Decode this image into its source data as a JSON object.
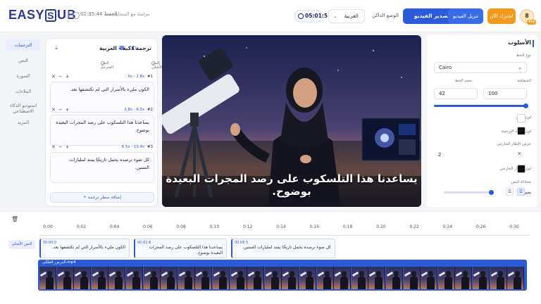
{
  "header": {
    "logo": "EASYSUB",
    "autosave_time": "02:35:44 الحفظ",
    "autosave_text": "مزامنة مع السحابة بعد",
    "duration": "05:01:51",
    "language": "العربية",
    "dark_mode": "الوضع الداكن",
    "export_label": "تصدير الفيديو",
    "download_label": "تنزيل الفيديو",
    "subscribe_label": "اشترك الآن",
    "avatar_initial": "8",
    "pro_badge": "Pro"
  },
  "nav": {
    "items": [
      "الترجمات",
      "النص",
      "الصورة",
      "الملاءات",
      "استوديو الذكاء الاصطناعي",
      "المزيد"
    ]
  },
  "subtitles": {
    "title": "ترجمة ذكية - العربية",
    "original_text_label": "النص الأصلي",
    "translated_text_label": "النص المترجم",
    "cues": [
      {
        "index": "#1",
        "time": "0s - 2.8s",
        "text": "الكون مليء بالأسرار التي لم نكتشفها بعد."
      },
      {
        "index": "#2",
        "time": "2.8s - 6.5s",
        "text": "يساعدنا هذا التلسكوب على رصد المجرات البعيدة بوضوح."
      },
      {
        "index": "#3",
        "time": "6.5s - 10.4s",
        "text": "كل ضوء نرصده يحمل تاريخًا يمتد لمليارات السنين."
      }
    ],
    "add_line_label": "+ إضافة سطر ترجمة"
  },
  "video": {
    "caption": "يساعدنا هذا التلسكوب على رصد المجرات البعيدة بوضوح."
  },
  "style": {
    "title": "الأسلوب",
    "font_type_label": "نوع الخط",
    "font_value": "Cairo",
    "font_size_label": "حجم الخط",
    "font_size_value": "42",
    "opacity_label": "الشفافية",
    "opacity_value": "100",
    "text_color_label": "لون النص",
    "text_color": "#ffffff",
    "bg_color_label": "لون خلفية الترجمة",
    "bg_color": "#111111",
    "outline_width_label": "عرض الإطار الخارجي",
    "outline_width_value": "2",
    "outline_color_label": "لون الإطار الخارجي",
    "outline_color": "#111111",
    "alignment_label": "محاذاة النص",
    "alignment_value": "يمين",
    "accent": "#2c5bd9"
  },
  "timeline": {
    "ticks": [
      "0:00",
      "0:02",
      "0:04",
      "0:06",
      "0:08",
      "0:10",
      "0:12",
      "0:14",
      "0:16",
      "0:18",
      "0:20",
      "0:22",
      "0:24",
      "0:26",
      "0:30"
    ],
    "track_label": "النص الأصلي",
    "segments": [
      {
        "start": "00:00.0",
        "text": "الكون مليء بالأسرار التي لم نكتشفها بعد."
      },
      {
        "start": "00:02.8",
        "text": "يساعدنا هذا التلسكوب على رصد المجرات البعيدة بوضوح."
      },
      {
        "start": "00:06.5",
        "text": "كل ضوء نرصده يحمل تاريخًا يمتد لمليارات السنين."
      }
    ],
    "video_track_title": "الدرس_الفلكي.mp4"
  }
}
